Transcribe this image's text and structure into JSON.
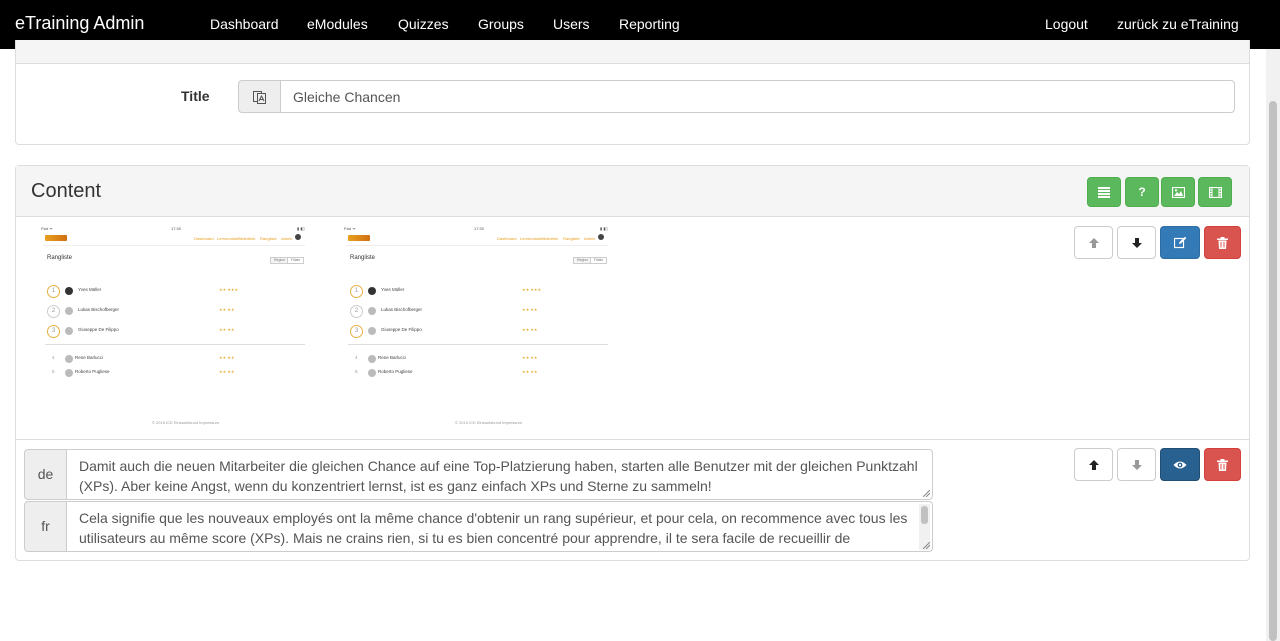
{
  "navbar": {
    "brand": "eTraining Admin",
    "items": [
      "Dashboard",
      "eModules",
      "Quizzes",
      "Groups",
      "Users",
      "Reporting"
    ],
    "right_items": [
      "Logout",
      "zurück zu eTraining"
    ]
  },
  "title_field": {
    "label": "Title",
    "value": "Gleiche Chancen"
  },
  "content_panel": {
    "heading": "Content",
    "preview": {
      "status_left": "Pad ᯤ",
      "status_time": "17:30",
      "status_right": "▮ ▮▯",
      "nav_links": [
        "Dashboard",
        "Lernmodule",
        "Bibliothek",
        "Rangliste",
        "Admin"
      ],
      "heading": "Rangliste",
      "toggle": [
        "Region",
        "Filiale"
      ],
      "entries": [
        {
          "rank": "1",
          "name": "Yves Müller",
          "score": "★★ ★★★"
        },
        {
          "rank": "2",
          "name": "Lukas Bischofberger",
          "score": "★★ ★★"
        },
        {
          "rank": "3",
          "name": "Giuseppe De Filippo",
          "score": "★★ ★★"
        },
        {
          "rank": "4",
          "name": "Rene Barlucci",
          "score": "★★ ★★"
        },
        {
          "rank": "5",
          "name": "Roberto Pugliese",
          "score": "★★ ★★"
        }
      ],
      "footer": "© 2015 ICE Einkaufsbund Impressum"
    },
    "text_rows": [
      {
        "lang": "de",
        "text": "Damit auch die neuen Mitarbeiter die gleichen Chance auf eine Top-Platzierung haben, starten alle Benutzer mit der gleichen Punktzahl (XPs). Aber keine Angst, wenn du konzentriert lernst, ist es ganz einfach XPs und Sterne zu sammeln!"
      },
      {
        "lang": "fr",
        "text": "Cela signifie que les nouveaux employés ont la même chance d'obtenir un rang supérieur, et pour cela, on recommence avec tous les utilisateurs au même score (XPs). Mais ne crains rien, si tu es bien concentré pour apprendre, il te sera facile de recueillir de l'expérience et des étoiles !"
      }
    ]
  },
  "icons": {
    "translate": "translate-icon",
    "list": "list-icon",
    "question": "question-icon",
    "image": "image-icon",
    "film": "film-icon",
    "arrow_up": "arrow-up-icon",
    "arrow_down": "arrow-down-icon",
    "edit": "edit-icon",
    "trash": "trash-icon",
    "eye": "eye-icon"
  },
  "colors": {
    "navbar_bg": "#000000",
    "success": "#5cb85c",
    "primary": "#337ab7",
    "primary_active": "#286090",
    "danger": "#d9534f"
  }
}
